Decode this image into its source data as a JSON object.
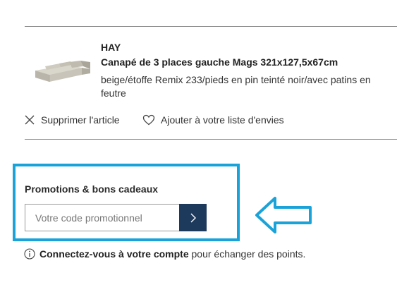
{
  "product": {
    "brand": "HAY",
    "name": "Canapé de 3 places gauche Mags 321x127,5x67cm",
    "description": "beige/étoffe Remix 233/pieds en pin teinté noir/avec patins en feutre"
  },
  "actions": {
    "remove_label": "Supprimer l'article",
    "wishlist_label": "Ajouter à votre liste d'envies"
  },
  "promo": {
    "title": "Promotions & bons cadeaux",
    "placeholder": "Votre code promotionnel",
    "value": ""
  },
  "login": {
    "link_text": "Connectez-vous à votre compte",
    "suffix_text": "pour échanger des points."
  },
  "colors": {
    "highlight": "#1aa3d8",
    "submit_button": "#1d3a5c",
    "divider": "#8a8a8a"
  },
  "icons": {
    "remove": "close-icon",
    "wishlist": "heart-icon",
    "submit": "chevron-right-icon",
    "info": "info-icon",
    "annotation": "arrow-left-icon"
  }
}
